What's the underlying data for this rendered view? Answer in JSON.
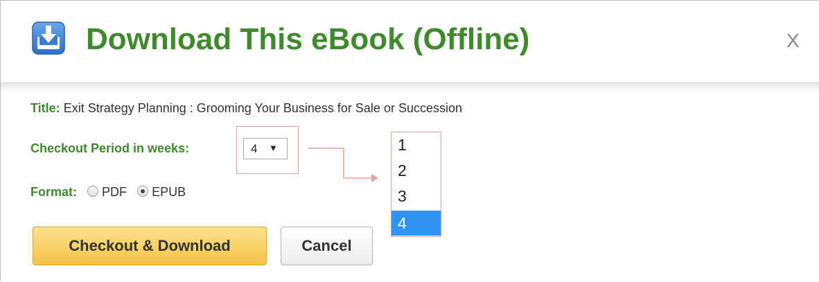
{
  "dialog": {
    "title": "Download This eBook (Offline)",
    "close_label": "X",
    "icon": "download-icon",
    "title_color": "#3f8a2d"
  },
  "form": {
    "title_label": "Title:",
    "title_value": "Exit Strategy Planning : Grooming Your Business for Sale or Succession",
    "period_label": "Checkout Period in weeks:",
    "period_selected": "4",
    "period_arrow": "▼",
    "period_options": [
      "1",
      "2",
      "3",
      "4"
    ],
    "format_label": "Format:",
    "format_options": [
      {
        "label": "PDF",
        "checked": false
      },
      {
        "label": "EPUB",
        "checked": true
      }
    ]
  },
  "buttons": {
    "checkout_label": "Checkout & Download",
    "cancel_label": "Cancel"
  },
  "colors": {
    "label_green": "#3f8a2d",
    "highlight_red": "#e8a2a2",
    "selected_blue": "#3294f2",
    "checkout_yellow": "#f6c343"
  }
}
